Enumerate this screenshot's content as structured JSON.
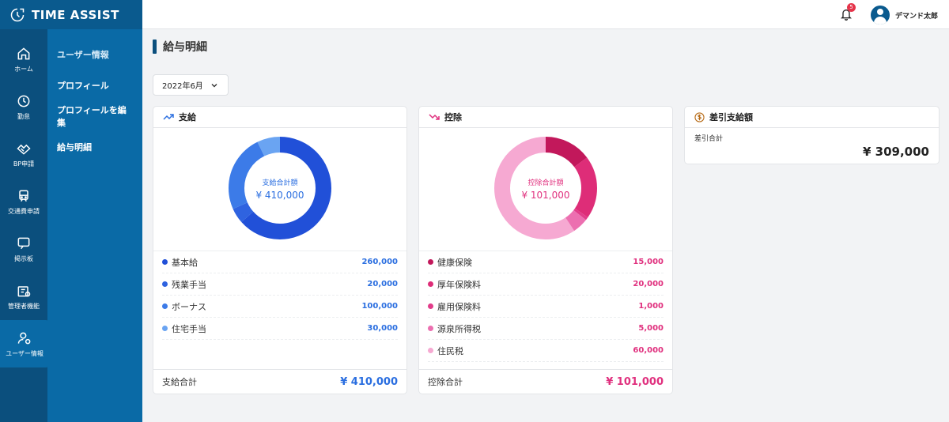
{
  "app": {
    "brand": "TIME ASSIST"
  },
  "rail": [
    {
      "label": "ホーム",
      "icon": "home-icon"
    },
    {
      "label": "勤怠",
      "icon": "clock-icon"
    },
    {
      "label": "BP申請",
      "icon": "handshake-icon"
    },
    {
      "label": "交通費申請",
      "icon": "train-icon"
    },
    {
      "label": "掲示板",
      "icon": "message-icon"
    },
    {
      "label": "管理者機能",
      "icon": "admin-icon"
    },
    {
      "label": "ユーザー情報",
      "icon": "user-gear-icon",
      "active": true
    }
  ],
  "submenu": {
    "header": "ユーザー情報",
    "items": [
      "プロフィール",
      "プロフィールを編集",
      "給与明細"
    ]
  },
  "topbar": {
    "notification_count": "5",
    "user_name": "デマンド太郎"
  },
  "page": {
    "title": "給与明細",
    "month": "2022年6月"
  },
  "payments": {
    "title": "支給",
    "center_label": "支給合計額",
    "center_value": "¥ 410,000",
    "items": [
      {
        "name": "基本給",
        "amount": "260,000",
        "value": 260000,
        "color": "#2150d8"
      },
      {
        "name": "残業手当",
        "amount": "20,000",
        "value": 20000,
        "color": "#2f63e0"
      },
      {
        "name": "ボーナス",
        "amount": "100,000",
        "value": 100000,
        "color": "#3c7be8"
      },
      {
        "name": "住宅手当",
        "amount": "30,000",
        "value": 30000,
        "color": "#6aa4f2"
      }
    ],
    "total_label": "支給合計",
    "total_value": "¥ 410,000",
    "accent": "#2a6ee0"
  },
  "deductions": {
    "title": "控除",
    "center_label": "控除合計額",
    "center_value": "¥ 101,000",
    "items": [
      {
        "name": "健康保険",
        "amount": "15,000",
        "value": 15000,
        "color": "#c2185b"
      },
      {
        "name": "厚年保険料",
        "amount": "20,000",
        "value": 20000,
        "color": "#de2d78"
      },
      {
        "name": "雇用保険料",
        "amount": "1,000",
        "value": 1000,
        "color": "#e23c8a"
      },
      {
        "name": "源泉所得税",
        "amount": "5,000",
        "value": 5000,
        "color": "#ec6fb0"
      },
      {
        "name": "住民税",
        "amount": "60,000",
        "value": 60000,
        "color": "#f6a9d2"
      }
    ],
    "total_label": "控除合計",
    "total_value": "¥ 101,000",
    "accent": "#e0307e"
  },
  "net": {
    "title": "差引支給額",
    "label": "差引合計",
    "value": "¥ 309,000"
  }
}
